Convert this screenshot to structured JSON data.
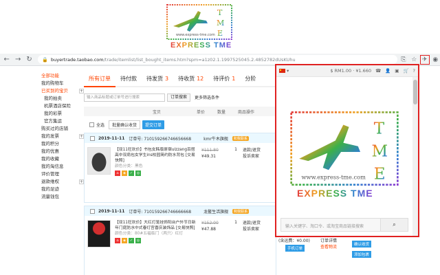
{
  "logo": {
    "url_text": "www.express-tme.com",
    "brand_text": "EXPRESS TME",
    "mark_letters": [
      "T",
      "M",
      "E"
    ]
  },
  "browser": {
    "url_host": "buyertrade.taobao.com",
    "url_path": "/trade/itemlist/list_bought_items.htm?spm=a1z02.1.1997525045.2.4852782dUsKUhu",
    "icons": [
      "back-icon",
      "forward-icon",
      "reload-icon",
      "home-icon",
      "translate-icon",
      "star-icon",
      "extension-plane-icon",
      "profile-icon"
    ]
  },
  "sidebar": {
    "items": [
      {
        "label": "全部功能",
        "red": true
      },
      {
        "label": "我的购物车"
      },
      {
        "label": "已买到的宝贝",
        "red": true,
        "plus": true
      },
      {
        "label": "我的拍卖",
        "sub": true
      },
      {
        "label": "机票酒店保险",
        "sub": true
      },
      {
        "label": "我的彩票",
        "sub": true
      },
      {
        "label": "官方集运",
        "sub": true
      },
      {
        "label": "购买过的店铺"
      },
      {
        "label": "我的发票",
        "plus": true
      },
      {
        "label": "我的积分"
      },
      {
        "label": "我的优惠"
      },
      {
        "label": "我的收藏"
      },
      {
        "label": "我的淘信息"
      },
      {
        "label": "评价管理"
      },
      {
        "label": "退款维权",
        "plus": true
      },
      {
        "label": "我的足迹"
      },
      {
        "label": "流量钱包"
      }
    ]
  },
  "tabs": [
    {
      "label": "所有订单",
      "count": ""
    },
    {
      "label": "待付款",
      "count": ""
    },
    {
      "label": "待发货",
      "count": "3"
    },
    {
      "label": "待收货",
      "count": "12"
    },
    {
      "label": "待评价",
      "count": "1"
    },
    {
      "label": "分阶",
      "count": ""
    }
  ],
  "search": {
    "placeholder": "输入商品标题或订单号进行搜索",
    "button": "订单搜索",
    "more": "更多筛选条件"
  },
  "table_head": {
    "item": "宝贝",
    "price": "单价",
    "qty": "数量",
    "after": "商品操作"
  },
  "select_row": {
    "all": "全选",
    "bulk": "批量确认收货",
    "blue_btn": "提交订单"
  },
  "orders": [
    {
      "date": "2019-11-11",
      "order_no_label": "订单号:",
      "order_no": "710159266746656668",
      "shop": "kmr牛木旗舰",
      "chat": "和我联系",
      "title": "【双11狂欢价】书包女韩版原宿ulzzang百搭高中双肩包女学生ins校园简约防水背包 [交易快照]",
      "attr": "颜色分类：黑色",
      "old_price": "¥111.80",
      "price": "¥49.31",
      "qty": "1",
      "svc": [
        "退款/退货",
        "投诉卖家"
      ]
    },
    {
      "date": "2019-11-11",
      "order_no_label": "订单号:",
      "order_no": "710159266746666668",
      "shop": "龙鳌生活旗舰",
      "chat": "和我联系",
      "title": "【双11狂欢价】大红灯笼挂饰阳台户外节日新年门庭防水中式春灯宫喜庆装饰品 [交易快照]",
      "attr": "颜色分类：80#五福临门（两只）红灯",
      "old_price": "¥152.00",
      "price": "¥47.88",
      "qty": "1",
      "svc": [
        "退款/退货",
        "投诉卖家"
      ]
    }
  ],
  "right_col": {
    "tax": "(含运费：¥0.00)",
    "detail": "订单详情",
    "logistics": "查看物流",
    "confirm": "确认收货",
    "add": "添加包裹",
    "pay_badge": "手机订单"
  },
  "popup": {
    "balance": "$ RM1.00 · ¥1.660",
    "search_placeholder": "输入关键字、淘口令、或淘宝商品链接搜索",
    "brand_text": "EXPRESS TME",
    "url_text": "www.express-tme.com"
  },
  "colors": {
    "accent": "#ff4400",
    "popup_border": "#e02020",
    "blue": "#2e9ce6"
  }
}
